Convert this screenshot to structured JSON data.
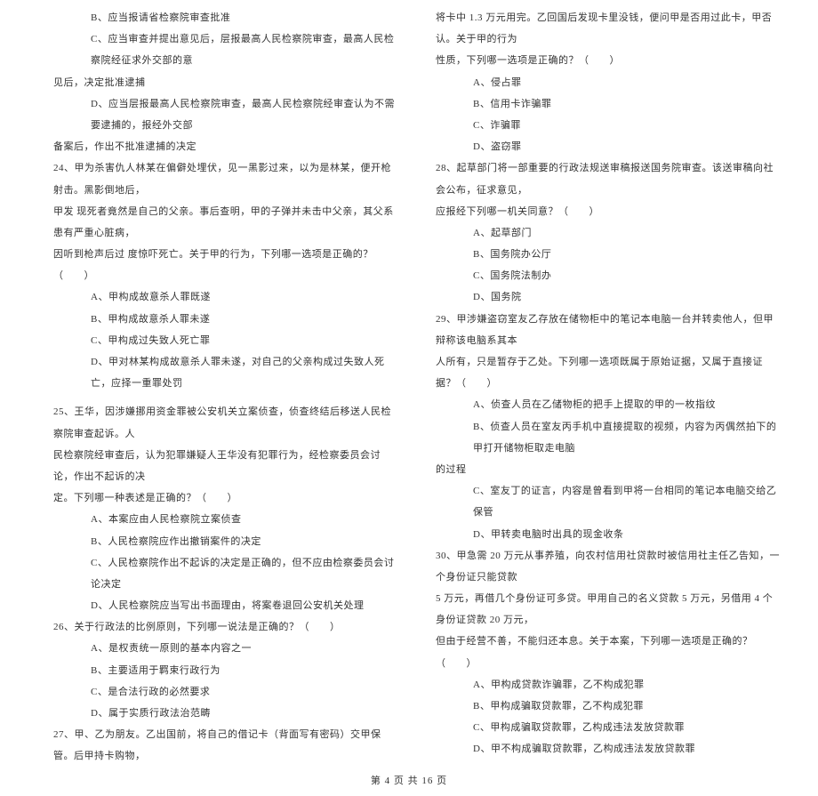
{
  "left": {
    "l1": "B、应当报请省检察院审查批准",
    "l2": "C、应当审查并提出意见后，层报最高人民检察院审查，最高人民检察院经征求外交部的意",
    "l3": "见后，决定批准逮捕",
    "l4": "D、应当层报最高人民检察院审查，最高人民检察院经审查认为不需要逮捕的，报经外交部",
    "l5": "备案后，作出不批准逮捕的决定",
    "q24_1": "24、甲为杀害仇人林某在偏僻处埋伏，见一黑影过来，以为是林某，便开枪射击。黑影倒地后，",
    "q24_2": "甲发 现死者竟然是自己的父亲。事后查明，甲的子弹并未击中父亲，其父系患有严重心脏病，",
    "q24_3": "因听到枪声后过 度惊吓死亡。关于甲的行为，下列哪一选项是正确的？（　　）",
    "q24_a": "A、甲构成故意杀人罪既遂",
    "q24_b": "B、甲构成故意杀人罪未遂",
    "q24_c": "C、甲构成过失致人死亡罪",
    "q24_d": "D、甲对林某构成故意杀人罪未遂，对自己的父亲构成过失致人死亡，应择一重罪处罚",
    "q25_1": "25、王华，因涉嫌挪用资金罪被公安机关立案侦查，侦查终结后移送人民检察院审查起诉。人",
    "q25_2": "民检察院经审查后，认为犯罪嫌疑人王华没有犯罪行为，经检察委员会讨论，作出不起诉的决",
    "q25_3": "定。下列哪一种表述是正确的？（　　）",
    "q25_a": "A、本案应由人民检察院立案侦查",
    "q25_b": "B、人民检察院应作出撤销案件的决定",
    "q25_c": "C、人民检察院作出不起诉的决定是正确的，但不应由检察委员会讨论决定",
    "q25_d": "D、人民检察院应当写出书面理由，将案卷退回公安机关处理",
    "q26_1": "26、关于行政法的比例原则，下列哪一说法是正确的？（　　）",
    "q26_a": "A、是权责统一原则的基本内容之一",
    "q26_b": "B、主要适用于羁束行政行为",
    "q26_c": "C、是合法行政的必然要求",
    "q26_d": "D、属于实质行政法治范畴",
    "q27_1": "27、甲、乙为朋友。乙出国前，将自己的借记卡（背面写有密码）交甲保管。后甲持卡购物，"
  },
  "right": {
    "r1": "将卡中 1.3 万元用完。乙回国后发现卡里没钱，便问甲是否用过此卡，甲否认。关于甲的行为",
    "r2": "性质，下列哪一选项是正确的？（　　）",
    "r_a": "A、侵占罪",
    "r_b": "B、信用卡诈骗罪",
    "r_c": "C、诈骗罪",
    "r_d": "D、盗窃罪",
    "q28_1": "28、起草部门将一部重要的行政法规送审稿报送国务院审查。该送审稿向社会公布，征求意见，",
    "q28_2": "应报经下列哪一机关同意？（　　）",
    "q28_a": "A、起草部门",
    "q28_b": "B、国务院办公厅",
    "q28_c": "C、国务院法制办",
    "q28_d": "D、国务院",
    "q29_1": "29、甲涉嫌盗窃室友乙存放在储物柜中的笔记本电脑一台并转卖他人，但甲辩称该电脑系其本",
    "q29_2": "人所有，只是暂存于乙处。下列哪一选项既属于原始证据，又属于直接证据？（　　）",
    "q29_a": "A、侦查人员在乙储物柜的把手上提取的甲的一枚指纹",
    "q29_b": "B、侦查人员在室友丙手机中直接提取的视频，内容为丙偶然拍下的甲打开储物柜取走电脑",
    "q29_b2": "的过程",
    "q29_c": "C、室友丁的证言，内容是曾看到甲将一台相同的笔记本电脑交给乙保管",
    "q29_d": "D、甲转卖电脑时出具的现金收条",
    "q30_1": "30、甲急需 20 万元从事养殖，向农村信用社贷款时被信用社主任乙告知，一个身份证只能贷款",
    "q30_2": "5 万元，再借几个身份证可多贷。甲用自己的名义贷款 5 万元，另借用 4 个身份证贷款 20 万元，",
    "q30_3": "但由于经营不善，不能归还本息。关于本案，下列哪一选项是正确的？（　　）",
    "q30_a": "A、甲构成贷款诈骗罪，乙不构成犯罪",
    "q30_b": "B、甲构成骗取贷款罪，乙不构成犯罪",
    "q30_c": "C、甲构成骗取贷款罪，乙构成违法发放贷款罪",
    "q30_d": "D、甲不构成骗取贷款罪，乙构成违法发放贷款罪"
  },
  "footer": "第 4 页 共 16 页"
}
